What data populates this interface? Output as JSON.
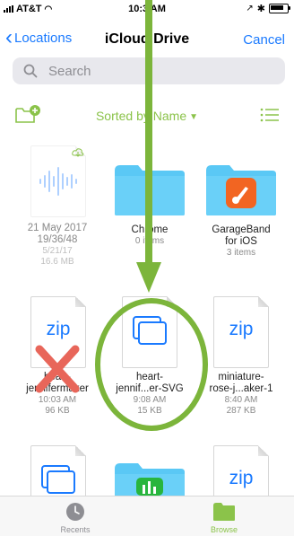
{
  "status": {
    "carrier": "AT&T",
    "time": "10:3 AM"
  },
  "nav": {
    "back_label": "Locations",
    "title": "iCloud Drive",
    "cancel_label": "Cancel"
  },
  "search": {
    "placeholder": "Search"
  },
  "toolbar": {
    "sort_label": "Sorted by Name"
  },
  "items": [
    {
      "name": "21 May 2017\n19/36/48",
      "meta1": "5/21/17",
      "meta2": "16.6 MB",
      "icon": "audio-file-icon"
    },
    {
      "name": "Chrome",
      "meta1": "0 items",
      "icon": "folder-icon"
    },
    {
      "name": "GarageBand\nfor iOS",
      "meta1": "3 items",
      "icon": "garageband-folder-icon"
    },
    {
      "name": "heart-\njennifermaker",
      "meta1": "10:03 AM",
      "meta2": "96 KB",
      "icon": "zip-file-icon"
    },
    {
      "name": "heart-\njennif...er-SVG",
      "meta1": "9:08 AM",
      "meta2": "15 KB",
      "icon": "svg-folder-file-icon"
    },
    {
      "name": "miniature-\nrose-j...aker-1",
      "meta1": "8:40 AM",
      "meta2": "287 KB",
      "icon": "zip-file-icon"
    }
  ],
  "zip_text": "zip",
  "tabs": [
    {
      "label": "Recents"
    },
    {
      "label": "Browse"
    }
  ],
  "colors": {
    "accent": "#1a7aff",
    "green": "#8bc34a",
    "overlay_green": "#7cb53b",
    "red_x": "#e8665a",
    "folder_blue": "#5ac8f5"
  }
}
